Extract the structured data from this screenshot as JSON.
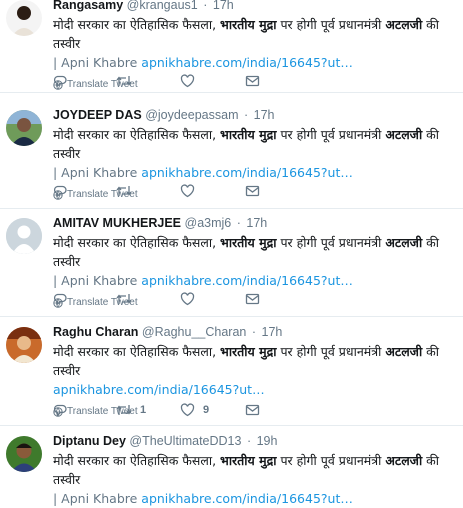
{
  "tweets": [
    {
      "name": "Rangasamy",
      "handle": "@krangaus1",
      "time": "17h",
      "text_pre": "मोदी सरकार का ऐतिहासिक फैसला, ",
      "text_bold1": "भारतीय मुद्रा",
      "text_mid": " पर होगी पूर्व प्रधानमंत्री ",
      "text_bold2": "अटलजी",
      "text_post": " की तस्वीर",
      "source": "| Apni Khabre ",
      "link": "apnikhabre.com/india/16645?ut…",
      "translate": "Translate Tweet",
      "retweets": "",
      "likes": ""
    },
    {
      "name": "JOYDEEP DAS",
      "handle": "@joydeepassam",
      "time": "17h",
      "text_pre": "मोदी सरकार का ऐतिहासिक फैसला, ",
      "text_bold1": "भारतीय मुद्रा",
      "text_mid": " पर होगी पूर्व प्रधानमंत्री ",
      "text_bold2": "अटलजी",
      "text_post": " की तस्वीर",
      "source": "| Apni Khabre ",
      "link": "apnikhabre.com/india/16645?ut…",
      "translate": "Translate Tweet",
      "retweets": "",
      "likes": ""
    },
    {
      "name": "AMITAV MUKHERJEE",
      "handle": "@a3mj6",
      "time": "17h",
      "text_pre": "मोदी सरकार का ऐतिहासिक फैसला, ",
      "text_bold1": "भारतीय मुद्रा",
      "text_mid": " पर होगी पूर्व प्रधानमंत्री ",
      "text_bold2": "अटलजी",
      "text_post": " की तस्वीर",
      "source": "| Apni Khabre ",
      "link": "apnikhabre.com/india/16645?ut…",
      "translate": "Translate Tweet",
      "retweets": "",
      "likes": ""
    },
    {
      "name": "Raghu Charan",
      "handle": "@Raghu__Charan",
      "time": "17h",
      "text_pre": "मोदी सरकार का ऐतिहासिक फैसला, ",
      "text_bold1": "भारतीय मुद्रा",
      "text_mid": " पर होगी पूर्व प्रधानमंत्री ",
      "text_bold2": "अटलजी",
      "text_post": " की तस्वीर",
      "source": "",
      "link": "apnikhabre.com/india/16645?ut…",
      "translate": "Translate Tweet",
      "retweets": "1",
      "likes": "9"
    },
    {
      "name": "Diptanu Dey",
      "handle": "@TheUltimateDD13",
      "time": "19h",
      "text_pre": "मोदी सरकार का ऐतिहासिक फैसला, ",
      "text_bold1": "भारतीय मुद्रा",
      "text_mid": " पर होगी पूर्व प्रधानमंत्री ",
      "text_bold2": "अटलजी",
      "text_post": " की तस्वीर",
      "source": "| Apni Khabre ",
      "link": "apnikhabre.com/india/16645?ut…",
      "translate": "",
      "retweets": "",
      "likes": ""
    }
  ],
  "colors": {
    "link": "#1b95e0",
    "muted": "#657786",
    "text": "#14171a",
    "divider": "#e6ecf0"
  },
  "icons": [
    "reply-icon",
    "retweet-icon",
    "like-icon",
    "direct-message-icon",
    "globe-icon",
    "more-icon"
  ]
}
